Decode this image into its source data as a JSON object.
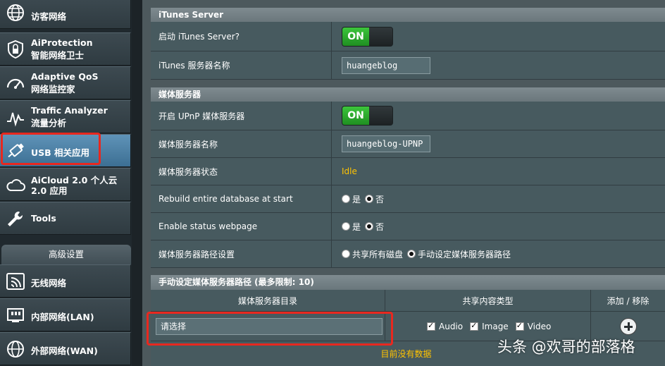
{
  "sidebar": {
    "items": [
      {
        "line1": "访客网络",
        "line2": "",
        "icon": "globe-icon"
      },
      {
        "line1": "AiProtection",
        "line2": "智能网络卫士",
        "icon": "shield-lock-icon"
      },
      {
        "line1": "Adaptive QoS",
        "line2": "网络监控家",
        "icon": "speedometer-icon"
      },
      {
        "line1": "Traffic Analyzer",
        "line2": "流量分析",
        "icon": "traffic-chart-icon"
      },
      {
        "line1": "USB 相关应用",
        "line2": "",
        "icon": "usb-icon"
      },
      {
        "line1": "AiCloud 2.0 个人云",
        "line2": "2.0 应用",
        "icon": "cloud-icon"
      },
      {
        "line1": "Tools",
        "line2": "",
        "icon": "wrench-icon"
      }
    ],
    "advanced_header": "高级设置",
    "advanced_items": [
      {
        "label": "无线网络",
        "icon": "wifi-icon"
      },
      {
        "label": "内部网络(LAN)",
        "icon": "lan-icon"
      },
      {
        "label": "外部网络(WAN)",
        "icon": "globe-icon"
      }
    ]
  },
  "itunes": {
    "header": "iTunes Server",
    "enable_label": "启动 iTunes Server?",
    "enable_state": "ON",
    "name_label": "iTunes 服务器名称",
    "name_value": "huangeblog"
  },
  "media": {
    "header": "媒体服务器",
    "upnp_label": "开启 UPnP 媒体服务器",
    "upnp_state": "ON",
    "name_label": "媒体服务器名称",
    "name_value": "huangeblog-UPNP",
    "status_label": "媒体服务器状态",
    "status_value": "Idle",
    "rebuild_label": "Rebuild entire database at start",
    "status_page_label": "Enable status webpage",
    "yes": "是",
    "no": "否",
    "path_label": "媒体服务器路径设置",
    "path_opt_all": "共享所有磁盘",
    "path_opt_manual": "手动设定媒体服务器路径"
  },
  "manual_path": {
    "header": "手动设定媒体服务器路径 (最多限制: 10)",
    "col_dir": "媒体服务器目录",
    "col_type": "共享内容类型",
    "col_action": "添加 / 移除",
    "dir_placeholder": "请选择",
    "types": [
      "Audio",
      "Image",
      "Video"
    ],
    "empty_text": "目前没有数据"
  },
  "watermark": "头条 @欢哥的部落格",
  "colors": {
    "highlight": "#e8281f",
    "status": "#ffc300",
    "toggle_on": "#2fae31"
  }
}
